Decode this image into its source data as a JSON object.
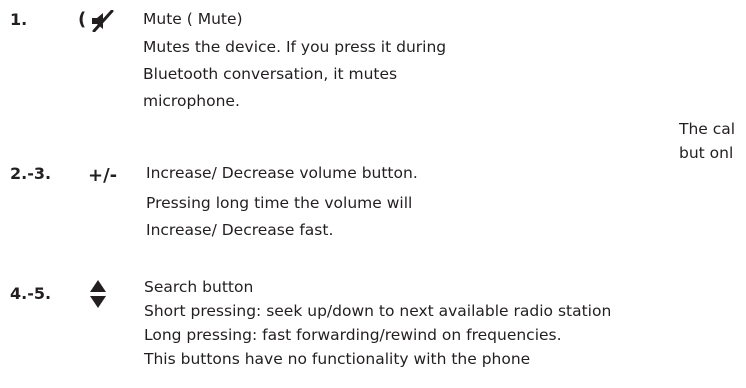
{
  "items": [
    {
      "number": "1.",
      "symbol": "(",
      "icon": "mute-speaker-icon",
      "title": "Mute ( Mute)",
      "lines": [
        "Mutes the device. If you press it during",
        "Bluetooth conversation, it mutes",
        "microphone."
      ]
    },
    {
      "number": "2.-3.",
      "symbol": "+/-",
      "title": "Increase/ Decrease volume button.",
      "lines": [
        "Pressing long time the volume will",
        "Increase/ Decrease fast."
      ]
    },
    {
      "number": "4.-5.",
      "icon": "up-down-arrows-icon",
      "title": "Search button",
      "lines": [
        "Short pressing: seek up/down to next available radio station",
        "Long pressing: fast forwarding/rewind on frequencies.",
        "This buttons have no functionality  with the phone"
      ]
    }
  ],
  "side_text": [
    "The cal",
    "but onl"
  ],
  "colors": {
    "text": "#231f20"
  }
}
